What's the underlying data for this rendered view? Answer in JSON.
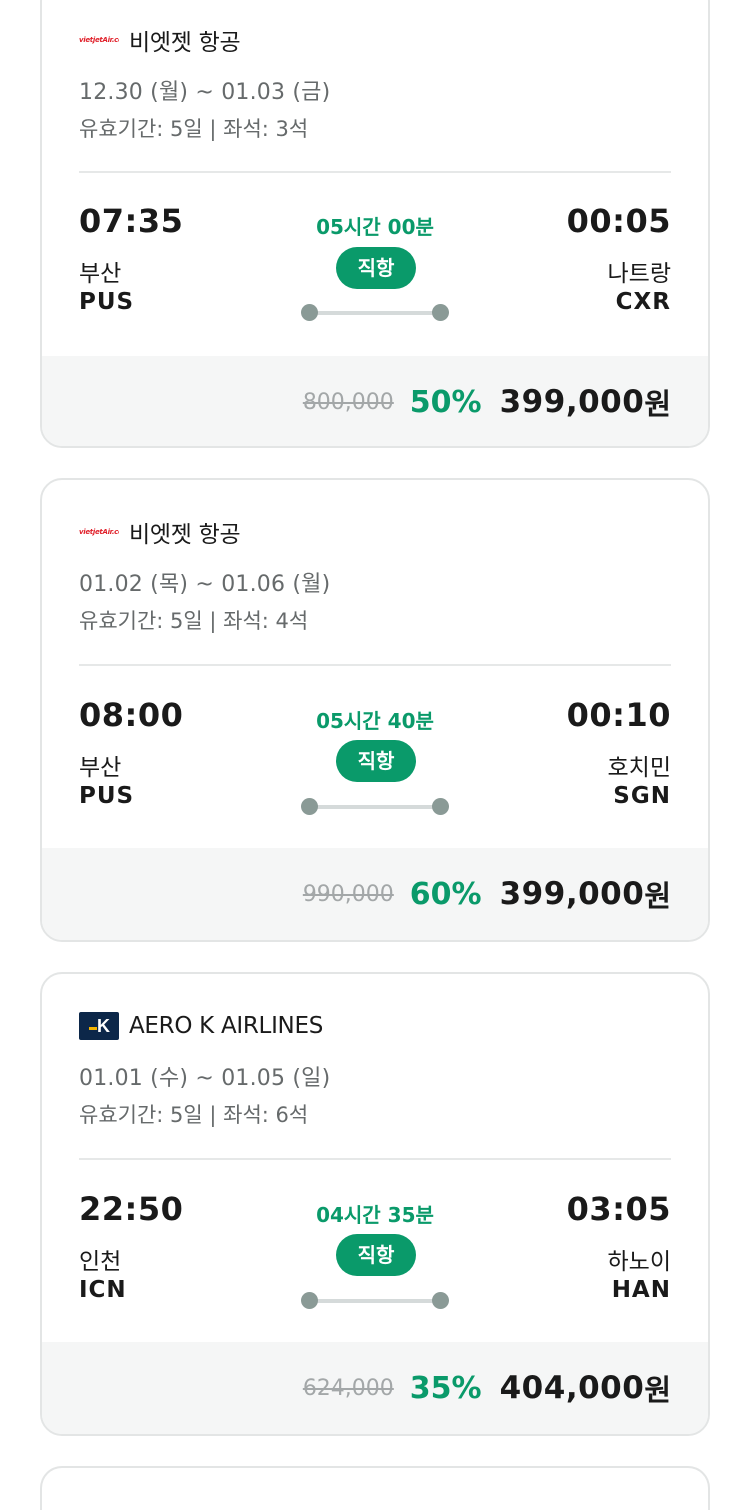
{
  "flights": [
    {
      "airline": "비엣젯 항공",
      "logo": "vietjet-logo",
      "logo_text": "vietjetAir.com",
      "dates": "12.30 (월) ~ 01.03 (금)",
      "validity": "유효기간: 5일 | 좌석: 3석",
      "dep_time": "07:35",
      "dep_city": "부산",
      "dep_code": "PUS",
      "duration": "05시간 00분",
      "direct": "직항",
      "arr_time": "00:05",
      "arr_city": "나트랑",
      "arr_code": "CXR",
      "original_price": "800,000",
      "discount": "50%",
      "price": "399,000",
      "currency": "원"
    },
    {
      "airline": "비엣젯 항공",
      "logo": "vietjet-logo",
      "logo_text": "vietjetAir.com",
      "dates": "01.02 (목) ~ 01.06 (월)",
      "validity": "유효기간: 5일 | 좌석: 4석",
      "dep_time": "08:00",
      "dep_city": "부산",
      "dep_code": "PUS",
      "duration": "05시간 40분",
      "direct": "직항",
      "arr_time": "00:10",
      "arr_city": "호치민",
      "arr_code": "SGN",
      "original_price": "990,000",
      "discount": "60%",
      "price": "399,000",
      "currency": "원"
    },
    {
      "airline": "AERO K AIRLINES",
      "logo": "aerok-logo",
      "logo_text": "K",
      "dates": "01.01 (수) ~ 01.05 (일)",
      "validity": "유효기간: 5일 | 좌석: 6석",
      "dep_time": "22:50",
      "dep_city": "인천",
      "dep_code": "ICN",
      "duration": "04시간 35분",
      "direct": "직항",
      "arr_time": "03:05",
      "arr_city": "하노이",
      "arr_code": "HAN",
      "original_price": "624,000",
      "discount": "35%",
      "price": "404,000",
      "currency": "원"
    }
  ],
  "colors": {
    "accent": "#0a9a6a",
    "muted_text": "#666a6b",
    "strike_price": "#a3a7a8",
    "card_border": "#e3e5e5",
    "price_bg": "#f5f6f6",
    "route_dot": "#8a9a96"
  }
}
